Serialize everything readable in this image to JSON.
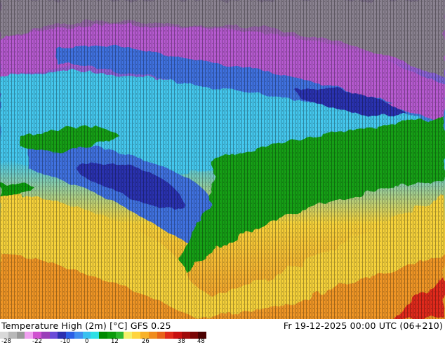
{
  "map": {
    "title": "Temperature High (2m) [°C] GFS 0.25",
    "valid_time": "Fr 19-12-2025 00:00 UTC (06+210)",
    "colorbar": {
      "tick_labels": [
        "-28",
        "-22",
        "-10",
        "0",
        "12",
        "26",
        "38",
        "48"
      ],
      "colors": [
        "#d9d9d9",
        "#b8b8b8",
        "#999999",
        "#f0a0f0",
        "#d050d0",
        "#9a3fb8",
        "#6a4ad8",
        "#2b30b0",
        "#2a5fe6",
        "#3f8ef0",
        "#38c0f0",
        "#2ee0e6",
        "#008a00",
        "#0c9c0c",
        "#2eb82e",
        "#f4f06a",
        "#ffd43c",
        "#f8b22a",
        "#f08c1e",
        "#e8641a",
        "#e02a1a",
        "#c81010",
        "#a00a0a",
        "#7a0606",
        "#4c0202"
      ]
    },
    "palette": {
      "ocean_cold": "#888888",
      "arctic_magenta": "#b65ad0",
      "frost_blue": "#3f72e0",
      "cold_cyan": "#45c8ee",
      "mild_green": "#16a016",
      "warm_yellow": "#f6d23a",
      "hot_orange": "#f09628",
      "hot_red": "#e02a1a"
    }
  }
}
